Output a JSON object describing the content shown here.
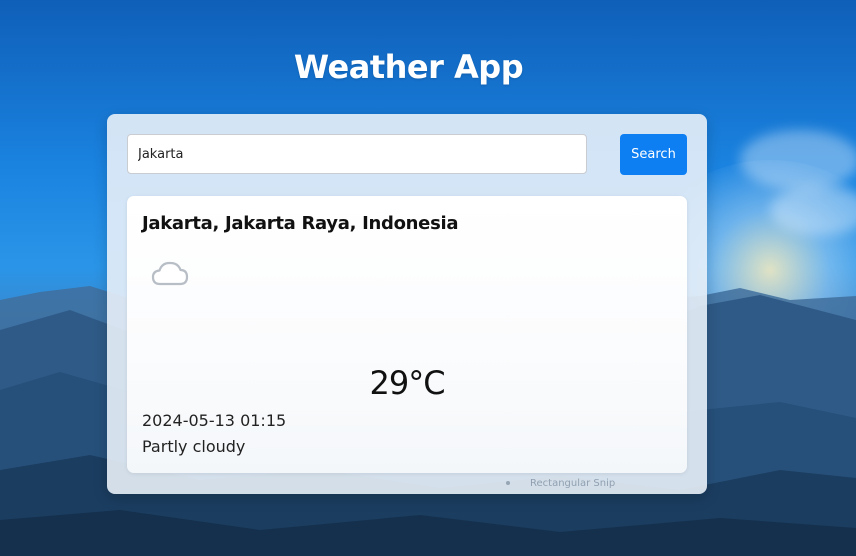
{
  "app": {
    "title": "Weather App"
  },
  "search": {
    "value": "Jakarta",
    "button_label": "Search"
  },
  "weather": {
    "location": "Jakarta, Jakarta Raya, Indonesia",
    "icon": "moon-cloud-icon",
    "temperature": "29°C",
    "datetime": "2024-05-13 01:15",
    "condition": "Partly cloudy"
  },
  "overlay": {
    "snip_label": "Rectangular Snip"
  },
  "colors": {
    "accent": "#0d7ff2",
    "moon": "#1d6fd8",
    "cloud_outline": "#b8bec6"
  }
}
